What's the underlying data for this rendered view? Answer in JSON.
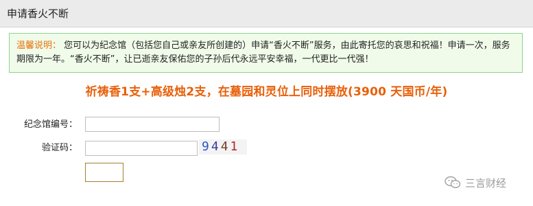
{
  "header": {
    "title": "申请香火不断"
  },
  "notice": {
    "label": "温馨说明：",
    "text": "您可以为纪念馆（包括您自己或亲友所创建的）申请“香火不断”服务，由此寄托您的哀思和祝福！申请一次，服务期限为一年。“香火不断”，让已逝亲友保佑您的子孙后代永远平安幸福，一代更比一代强！"
  },
  "headline": "祈祷香1支+高级烛2支，在墓园和灵位上同时摆放(3900 天国币/年)",
  "form": {
    "memorial_label": "纪念馆编号：",
    "memorial_value": "",
    "captcha_label": "验证码：",
    "captcha_value": "",
    "captcha_chars": [
      "9",
      "4",
      "4",
      "1"
    ],
    "submit_label": ""
  },
  "watermark": {
    "text": "三言财经",
    "icon": "wechat-icon"
  }
}
